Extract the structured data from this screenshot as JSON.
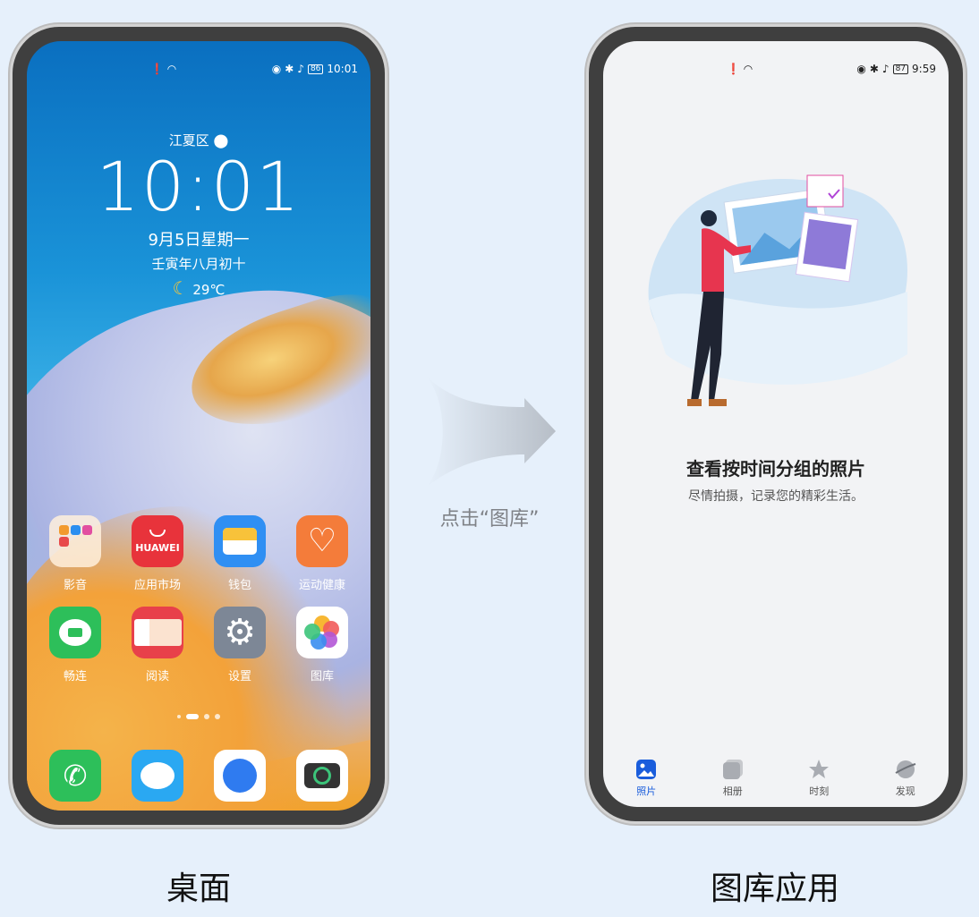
{
  "home": {
    "status_time": "10:01",
    "battery": "86",
    "location": "江夏区",
    "clock": "10:01",
    "date": "9月5日星期一",
    "lunar": "壬寅年八月初十",
    "temperature": "29℃",
    "apps": [
      {
        "label": "影音",
        "icon": "media-folder-icon"
      },
      {
        "label": "应用市场",
        "icon": "app-gallery-icon",
        "badge": "HUAWEI"
      },
      {
        "label": "钱包",
        "icon": "wallet-icon"
      },
      {
        "label": "运动健康",
        "icon": "health-icon"
      },
      {
        "label": "畅连",
        "icon": "meetime-icon"
      },
      {
        "label": "阅读",
        "icon": "books-icon"
      },
      {
        "label": "设置",
        "icon": "settings-gear-icon"
      },
      {
        "label": "图库",
        "icon": "gallery-pinwheel-icon"
      }
    ],
    "dock": [
      {
        "icon": "phone-icon"
      },
      {
        "icon": "messages-icon"
      },
      {
        "icon": "browser-icon"
      },
      {
        "icon": "camera-icon"
      }
    ]
  },
  "arrow_label": "点击“图库”",
  "gallery": {
    "status_time": "9:59",
    "battery": "87",
    "empty_title": "查看按时间分组的照片",
    "empty_subtitle": "尽情拍摄，记录您的精彩生活。",
    "tabs": [
      {
        "label": "照片",
        "icon": "photos-icon",
        "active": true
      },
      {
        "label": "相册",
        "icon": "albums-icon",
        "active": false
      },
      {
        "label": "时刻",
        "icon": "star-icon",
        "active": false
      },
      {
        "label": "发现",
        "icon": "planet-icon",
        "active": false
      }
    ]
  },
  "captions": {
    "left": "桌面",
    "right": "图库应用"
  },
  "colors": {
    "accent": "#1a5ddc",
    "background": "#e6f0fb"
  }
}
